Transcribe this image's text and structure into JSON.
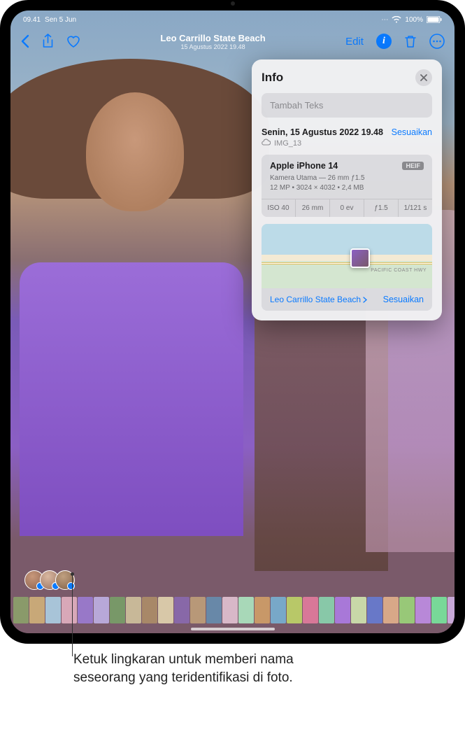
{
  "statusbar": {
    "time": "09.41",
    "date": "Sen 5 Jun",
    "battery_pct": "100%"
  },
  "toolbar": {
    "title": "Leo Carrillo State Beach",
    "subtitle": "15 Agustus 2022  19.48",
    "edit": "Edit"
  },
  "info_panel": {
    "title": "Info",
    "caption_placeholder": "Tambah Teks",
    "datetime": "Senin, 15 Agustus 2022 19.48",
    "adjust1": "Sesuaikan",
    "filename": "IMG_13",
    "camera_model": "Apple iPhone 14",
    "format_badge": "HEIF",
    "lens_line": "Kamera Utama — 26 mm ƒ1.5",
    "res_line": "12 MP • 3024 × 4032 • 2,4 MB",
    "exif": {
      "iso": "ISO 40",
      "focal": "26 mm",
      "ev": "0 ev",
      "fstop": "ƒ1.5",
      "shutter": "1/121 s"
    },
    "map_road": "PACIFIC COAST HWY",
    "location": "Leo Carrillo State Beach",
    "adjust2": "Sesuaikan"
  },
  "callout": "Ketuk lingkaran untuk memberi nama seseorang yang teridentifikasi di foto.",
  "thumbs": [
    "#8a9a6a",
    "#c8a878",
    "#a8c4d8",
    "#d8a8b8",
    "#9878c8",
    "#b8a8d8",
    "#789868",
    "#c8b898",
    "#a88868",
    "#d8c8a8",
    "#8868a8",
    "#b89878",
    "#6888a8",
    "#d8b8c8",
    "#a8d8b8",
    "#c89868",
    "#78a8c8",
    "#b8c868",
    "#d87898",
    "#88c8a8",
    "#a878d8",
    "#c8d8a8",
    "#6878c8",
    "#d8a888",
    "#98c878",
    "#b888d8",
    "#78d898",
    "#c8a8d8"
  ]
}
